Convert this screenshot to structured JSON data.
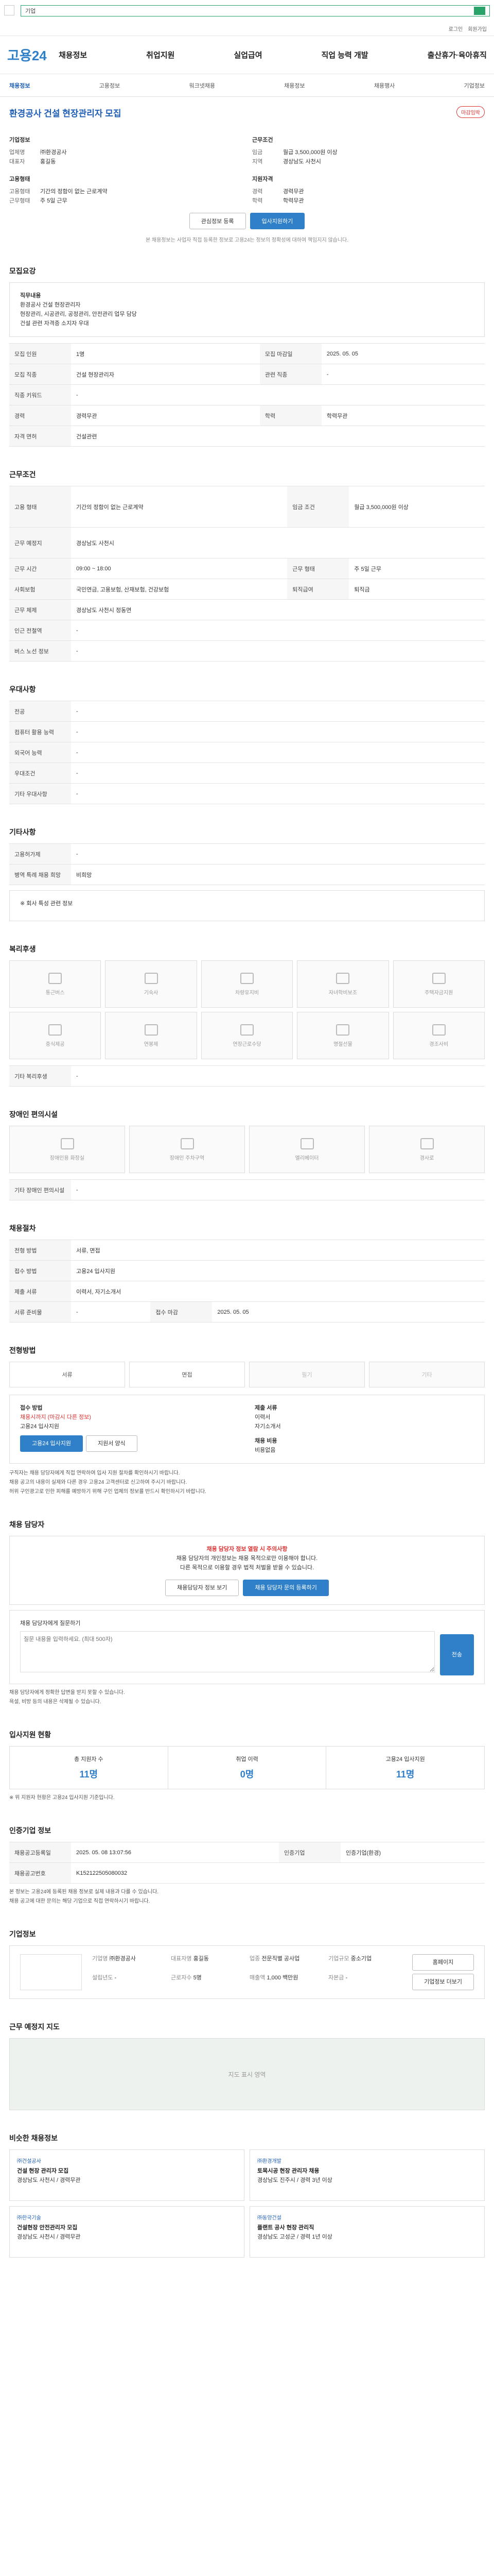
{
  "topbar": {
    "search_value": "기업",
    "util": [
      "로그인",
      "회원가입"
    ]
  },
  "gnb": {
    "logo": "고용24",
    "menu": [
      "채용정보",
      "취업지원",
      "실업급여",
      "직업 능력 개발",
      "출산휴가·육아휴직"
    ]
  },
  "subnav": [
    "채용정보",
    "고용정보",
    "워크넷채용",
    "채용정보",
    "채용행사",
    "기업정보"
  ],
  "job": {
    "title": "환경공사 건설 현장관리자 모집",
    "badge": "마감임박",
    "company_label": "기업정보",
    "company": [
      [
        "업체명",
        "㈜환경공사"
      ],
      [
        "대표자",
        "홍길동"
      ]
    ],
    "condition_label": "지원자격",
    "condition": [
      [
        "경력",
        "경력무관"
      ],
      [
        "학력",
        "학력무관"
      ]
    ],
    "work_label": "근무조건",
    "work": [
      [
        "임금",
        "월급 3,500,000원 이상"
      ],
      [
        "지역",
        "경상남도 사천시"
      ]
    ],
    "employ_label": "고용형태",
    "employ": [
      [
        "고용형태",
        "기간의 정함이 없는 근로계약"
      ],
      [
        "근무형태",
        "주 5일 근무"
      ]
    ],
    "apply_label": "채용마감일",
    "apply": "2025. 05. 05"
  },
  "buttons": {
    "scrap": "관심정보 등록",
    "apply": "입사지원하기"
  },
  "notice": "본 채용정보는 사업자 직접 등록한 정보로 고용24는 정보의 정확성에 대하여 책임지지 않습니다.",
  "sections": {
    "recruit": "모집요강",
    "cond": "근무조건",
    "qual": "우대사항",
    "etc": "기타사항",
    "welfare": "복리후생",
    "barrier": "장애인 편의시설",
    "apply": "채용절차",
    "method": "전형방법",
    "contact": "채용 담당자",
    "stats": "입사지원 현황",
    "info": "인증기업 정보",
    "company": "기업정보",
    "map": "근무 예정지 지도",
    "reco": "비슷한 채용정보"
  },
  "recruit_box": [
    "직무내용",
    "환경공사 건설 현장관리자",
    "현장관리, 시공관리, 공정관리, 안전관리 업무 담당",
    "건설 관련 자격증 소지자 우대"
  ],
  "recruit_table": [
    [
      "모집 인원",
      "1명",
      "모집 마감일",
      "2025. 05. 05"
    ],
    [
      "모집 직종",
      "건설 현장관리자",
      "관련 직종",
      "-"
    ],
    [
      "직종 키워드",
      "-",
      "",
      ""
    ],
    [
      "경력",
      "경력무관",
      "학력",
      "학력무관"
    ],
    [
      "자격 면허",
      "건설관련",
      "",
      ""
    ]
  ],
  "cond_table": [
    [
      "고용 형태",
      "기간의 정함이 없는 근로계약",
      "임금 조건",
      "월급 3,500,000원 이상"
    ],
    [
      "근무 예정지",
      "경상남도 사천시",
      "",
      ""
    ],
    [
      "근무 시간",
      "09:00 ~ 18:00",
      "근무 형태",
      "주 5일 근무"
    ],
    [
      "사회보험",
      "국민연금, 고용보험, 산재보험, 건강보험",
      "퇴직급여",
      "퇴직금"
    ],
    [
      "근무 체제",
      "경상남도 사천시 정동면",
      "",
      ""
    ],
    [
      "인근 전철역",
      "-",
      "",
      ""
    ],
    [
      "버스 노선 정보",
      "-",
      "",
      ""
    ]
  ],
  "qual_table": [
    [
      "전공",
      "-"
    ],
    [
      "컴퓨터 활용 능력",
      "-"
    ],
    [
      "외국어 능력",
      "-"
    ],
    [
      "우대조건",
      "-"
    ],
    [
      "기타 우대사항",
      "-"
    ]
  ],
  "etc_table": [
    [
      "고용허가제",
      "-"
    ],
    [
      "병역 특례 채용 희망",
      "비희망"
    ]
  ],
  "etc_extra": "※ 회사 특성 관련 정보",
  "welfare_items": [
    "통근버스",
    "기숙사",
    "차량유지비",
    "자녀학비보조",
    "주택자금지원",
    "중식제공",
    "연봉제",
    "연장근로수당",
    "명절선물",
    "경조사비"
  ],
  "welfare_note": "기타 복리후생",
  "welfare_note_val": "-",
  "barrier_items": [
    "장애인용 화장실",
    "장애인 주차구역",
    "엘리베이터",
    "경사로"
  ],
  "barrier_note": "기타 장애인 편의시설",
  "barrier_note_val": "-",
  "apply_table": [
    [
      "전형 방법",
      "서류, 면접"
    ],
    [
      "접수 방법",
      "고용24 입사지원",
      "",
      ""
    ],
    [
      "제출 서류",
      "이력서, 자기소개서"
    ],
    [
      "서류 준비물",
      "-",
      "접수 마감",
      "2025. 05. 05"
    ]
  ],
  "methods": [
    {
      "l": "서류",
      "on": true
    },
    {
      "l": "면접",
      "on": true
    },
    {
      "l": "필기",
      "on": false
    },
    {
      "l": "기타",
      "on": false
    }
  ],
  "method_box": {
    "a_title": "접수 방법",
    "a_lines": [
      "채용시까지 (마감시 다른 정보)",
      "고용24 입사지원"
    ],
    "a_btn1": "고용24 입사지원",
    "a_btn2": "지원서 양식",
    "b_title": "제출 서류",
    "b_lines": [
      "이력서",
      "자기소개서"
    ],
    "c_title": "채용 비용",
    "c_lines": [
      "비용없음"
    ]
  },
  "method_bullets": [
    "구직자는 채용 담당자에게 직접 연락하여 입사 지원 절차를 확인하시기 바랍니다.",
    "채용 공고의 내용이 실제와 다른 경우 고용24 고객센터로 신고하여 주시기 바랍니다.",
    "허위 구인광고로 인한 피해를 예방하기 위해 구인 업체의 정보를 반드시 확인하시기 바랍니다."
  ],
  "contact": {
    "head": "채용 담당자 정보 열람 시 주의사항",
    "lines": [
      "채용 담당자의 개인정보는 채용 목적으로만 이용해야 합니다.",
      "다른 목적으로 이용할 경우 법적 처벌을 받을 수 있습니다."
    ],
    "btn1": "채용담당자 정보 보기",
    "btn2": "채용 담당자 문의 등록하기",
    "q_label": "채용 담당자에게 질문하기",
    "q_placeholder": "질문 내용을 입력하세요. (최대 500자)",
    "q_btn": "전송",
    "bullets": [
      "채용 담당자에게 정확한 답변을 받지 못할 수 있습니다.",
      "욕설, 비방 등의 내용은 삭제될 수 있습니다."
    ]
  },
  "stats": [
    {
      "l": "총 지원자 수",
      "v": "11명"
    },
    {
      "l": "취업 이력",
      "v": "0명"
    },
    {
      "l": "고용24 입사지원",
      "v": "11명"
    }
  ],
  "stats_note": "※ 위 지원자 현황은 고용24 입사지원 기준입니다.",
  "info_table": [
    [
      "채용공고등록일",
      "2025. 05. 08 13:07:56",
      "인증기업",
      "인증기업(환경)"
    ],
    [
      "채용공고번호",
      "K152122505080032",
      "",
      ""
    ]
  ],
  "info_bullets": [
    "본 정보는 고용24에 등록된 채용 정보로 실제 내용과 다를 수 있습니다.",
    "채용 공고에 대한 문의는 해당 기업으로 직접 연락하시기 바랍니다."
  ],
  "company_info": [
    [
      "기업명",
      "㈜환경공사"
    ],
    [
      "대표자명",
      "홍길동"
    ],
    [
      "업종",
      "전문직별 공사업"
    ],
    [
      "기업규모",
      "중소기업"
    ],
    [
      "설립년도",
      "-"
    ],
    [
      "근로자수",
      "5명"
    ],
    [
      "매출액",
      "1,000 백만원"
    ],
    [
      "자본금",
      "-"
    ]
  ],
  "company_btns": [
    "홈페이지",
    "기업정보 더보기"
  ],
  "map_note": "지도 표시 영역",
  "reco": [
    {
      "org": "㈜건설공사",
      "t": "건설 현장 관리자 모집",
      "d": "경상남도 사천시 / 경력무관"
    },
    {
      "org": "㈜환경개발",
      "t": "토목시공 현장 관리자 채용",
      "d": "경상남도 진주시 / 경력 3년 이상"
    },
    {
      "org": "㈜한국기술",
      "t": "건설현장 안전관리자 모집",
      "d": "경상남도 사천시 / 경력무관"
    },
    {
      "org": "㈜동양건설",
      "t": "플랜트 공사 현장 관리직",
      "d": "경상남도 고성군 / 경력 1년 이상"
    }
  ]
}
